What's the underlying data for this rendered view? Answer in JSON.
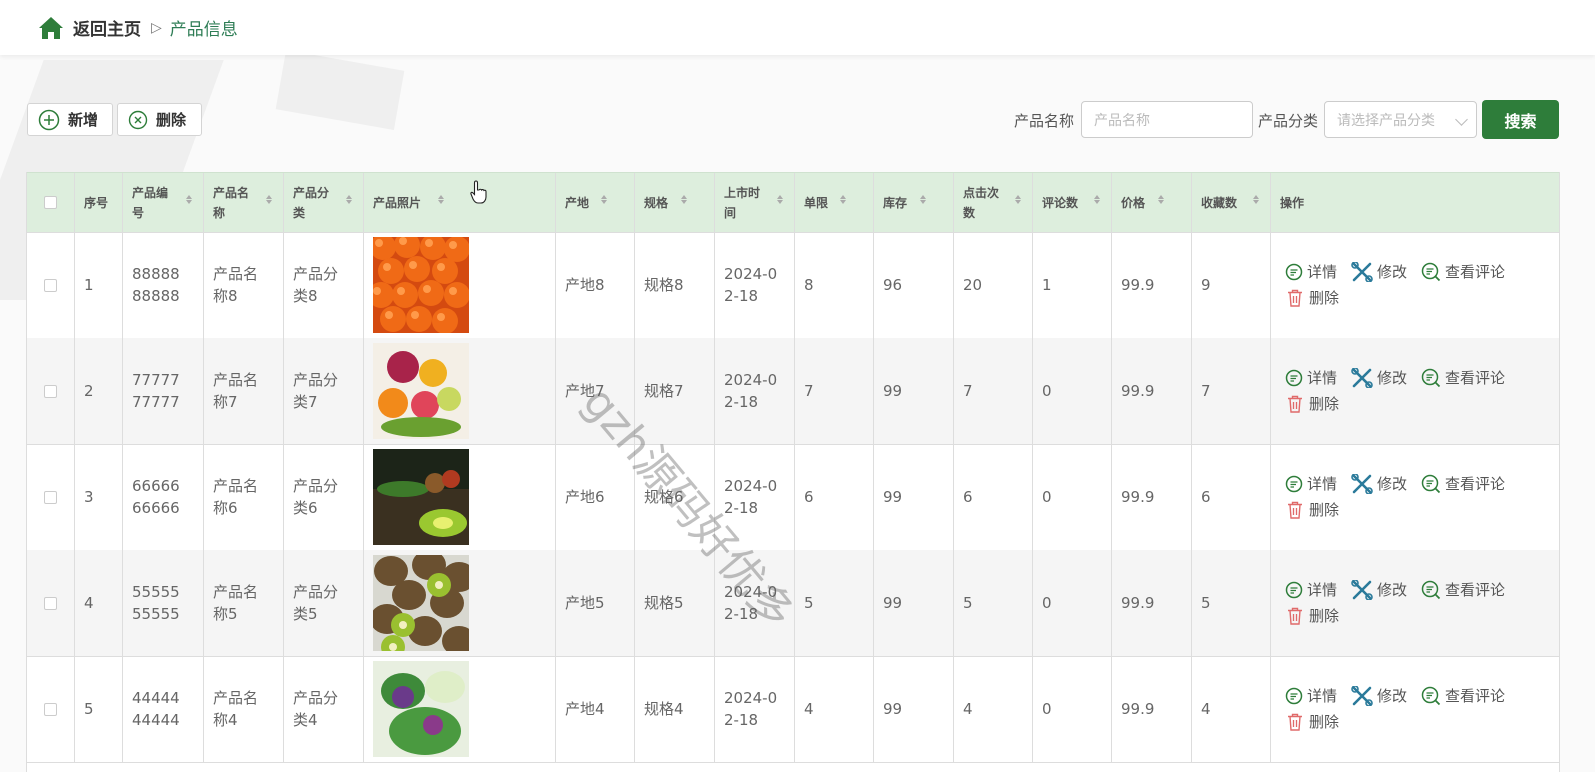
{
  "breadcrumb": {
    "home": "返回主页",
    "separator": "▷",
    "current": "产品信息"
  },
  "toolbar": {
    "add_label": "新增",
    "delete_label": "删除"
  },
  "search": {
    "name_label": "产品名称",
    "name_placeholder": "产品名称",
    "category_label": "产品分类",
    "category_placeholder": "请选择产品分类",
    "button_label": "搜索"
  },
  "table": {
    "headers": {
      "index": "序号",
      "code": "产品编号",
      "name": "产品名称",
      "category": "产品分类",
      "photo": "产品照片",
      "origin": "产地",
      "spec": "规格",
      "launch_date": "上市时间",
      "limit": "单限",
      "stock": "库存",
      "clicks": "点击次数",
      "reviews": "评论数",
      "price": "价格",
      "favorites": "收藏数",
      "actions": "操作"
    },
    "rows": [
      {
        "index": "1",
        "code": "8888888888",
        "name": "产品名称8",
        "category": "产品分类8",
        "photo": "oranges",
        "origin": "产地8",
        "spec": "规格8",
        "launch_date": "2024-02-18",
        "limit": "8",
        "stock": "96",
        "clicks": "20",
        "reviews": "1",
        "price": "99.9",
        "favorites": "9"
      },
      {
        "index": "2",
        "code": "7777777777",
        "name": "产品名称7",
        "category": "产品分类7",
        "photo": "fruit-assortment",
        "origin": "产地7",
        "spec": "规格7",
        "launch_date": "2024-02-18",
        "limit": "7",
        "stock": "99",
        "clicks": "7",
        "reviews": "0",
        "price": "99.9",
        "favorites": "7"
      },
      {
        "index": "3",
        "code": "6666666666",
        "name": "产品名称6",
        "category": "产品分类6",
        "photo": "vegetables-basket",
        "origin": "产地6",
        "spec": "规格6",
        "launch_date": "2024-02-18",
        "limit": "6",
        "stock": "99",
        "clicks": "6",
        "reviews": "0",
        "price": "99.9",
        "favorites": "6"
      },
      {
        "index": "4",
        "code": "5555555555",
        "name": "产品名称5",
        "category": "产品分类5",
        "photo": "kiwis",
        "origin": "产地5",
        "spec": "规格5",
        "launch_date": "2024-02-18",
        "limit": "5",
        "stock": "99",
        "clicks": "5",
        "reviews": "0",
        "price": "99.9",
        "favorites": "5"
      },
      {
        "index": "5",
        "code": "4444444444",
        "name": "产品名称4",
        "category": "产品分类4",
        "photo": "leafy-vegetables",
        "origin": "产地4",
        "spec": "规格4",
        "launch_date": "2024-02-18",
        "limit": "4",
        "stock": "99",
        "clicks": "4",
        "reviews": "0",
        "price": "99.9",
        "favorites": "4"
      }
    ],
    "actions": {
      "detail": "详情",
      "edit": "修改",
      "view_reviews": "查看评论",
      "delete": "删除"
    }
  },
  "watermark": "gzh源码好优多",
  "colors": {
    "primary": "#2e7d3a",
    "header_bg": "#ddeedd",
    "breadcrumb_current": "#2e7d55",
    "delete_red": "#e06a6a"
  }
}
